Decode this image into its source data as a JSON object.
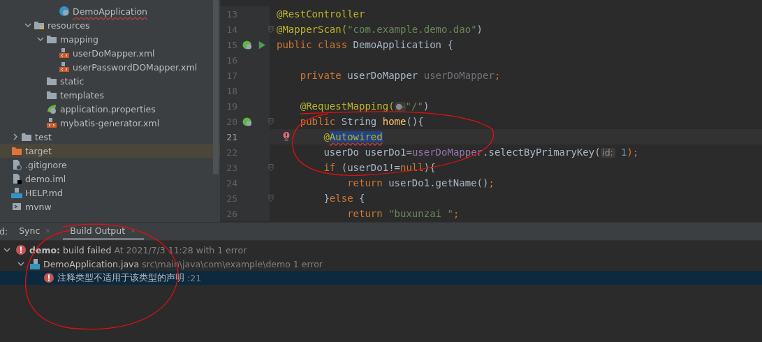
{
  "project_tree": [
    {
      "children": [
        {
          "children": [
            {
              "children": [
                {
                  "children": [
                    {
                      "label": "DemoApplication",
                      "kind": "java-class",
                      "error": true,
                      "selected": false
                    }
                  ]
                }
              ]
            },
            {
              "label": "resources",
              "kind": "resources-folder",
              "expanded": true,
              "selected": false,
              "children": [
                {
                  "label": "mapping",
                  "kind": "folder",
                  "expanded": true,
                  "selected": false,
                  "children": [
                    {
                      "label": "userDoMapper.xml",
                      "kind": "xml",
                      "selected": false
                    },
                    {
                      "label": "userPasswordDOMapper.xml",
                      "kind": "xml",
                      "selected": false
                    }
                  ]
                },
                {
                  "label": "static",
                  "kind": "folder",
                  "selected": false
                },
                {
                  "label": "templates",
                  "kind": "folder",
                  "selected": false
                },
                {
                  "label": "application.properties",
                  "kind": "properties",
                  "selected": false
                },
                {
                  "label": "mybatis-generator.xml",
                  "kind": "xml",
                  "selected": false
                }
              ]
            }
          ]
        },
        {
          "label": "test",
          "kind": "folder",
          "expanded": false,
          "selected": false
        }
      ]
    },
    {
      "label": "target",
      "kind": "excluded-folder",
      "selected": true
    },
    {
      "label": ".gitignore",
      "kind": "ignore",
      "selected": false
    },
    {
      "label": "demo.iml",
      "kind": "iml",
      "selected": false
    },
    {
      "label": "HELP.md",
      "kind": "md",
      "selected": false
    },
    {
      "label": "mvnw",
      "kind": "script",
      "selected": false
    }
  ],
  "editor": {
    "lines": [
      {
        "number": "13",
        "tokens": [
          {
            "text": "@RestController",
            "kind": "annotation"
          }
        ]
      },
      {
        "number": "14",
        "fold": true,
        "tokens": [
          {
            "text": "@MapperScan(",
            "kind": "annotation"
          },
          {
            "text": "\"com.example.demo.dao\"",
            "kind": "string"
          },
          {
            "text": ")",
            "kind": "plain"
          }
        ]
      },
      {
        "number": "15",
        "gutter": [
          {
            "kind": "bean"
          },
          {
            "kind": "run"
          }
        ],
        "tokens": [
          {
            "text": "public class ",
            "kind": "keyword"
          },
          {
            "text": "DemoApplication {",
            "kind": "plain"
          }
        ]
      },
      {
        "number": "16"
      },
      {
        "number": "17",
        "tokens": [
          {
            "text": "    private ",
            "kind": "keyword"
          },
          {
            "text": "userDoMapper ",
            "kind": "plain"
          },
          {
            "text": "userDoMapper",
            "kind": "unused"
          },
          {
            "text": ";",
            "kind": "keyword"
          }
        ]
      },
      {
        "number": "18"
      },
      {
        "number": "19",
        "tokens": [
          {
            "text": "    @RequestMapping(",
            "kind": "annotation"
          },
          {
            "kind": "globe-inlay"
          },
          {
            "text": "\"/\"",
            "kind": "string"
          },
          {
            "text": ")",
            "kind": "plain"
          }
        ]
      },
      {
        "number": "20",
        "fold": true,
        "gutter": [
          {
            "kind": "bean"
          }
        ],
        "tokens": [
          {
            "text": "    public ",
            "kind": "keyword"
          },
          {
            "text": "String ",
            "kind": "plain"
          },
          {
            "text": "home",
            "kind": "method"
          },
          {
            "text": "(){",
            "kind": "plain"
          }
        ]
      },
      {
        "number": "21",
        "current": true,
        "error": true,
        "tokens": [
          {
            "text": "        @",
            "kind": "annotation"
          },
          {
            "text": "Autowired",
            "kind": "selected-error"
          }
        ]
      },
      {
        "number": "22",
        "tokens": [
          {
            "text": "        userDo userDo1=",
            "kind": "plain"
          },
          {
            "text": "userDoMapper",
            "kind": "field"
          },
          {
            "text": ".selectByPrimaryKey(",
            "kind": "plain"
          },
          {
            "text": "id:",
            "kind": "inlay"
          },
          {
            "text": " 1",
            "kind": "number"
          },
          {
            "text": ");",
            "kind": "keyword"
          }
        ]
      },
      {
        "number": "23",
        "fold": true,
        "tokens": [
          {
            "text": "        if ",
            "kind": "keyword"
          },
          {
            "text": "(userDo1!=",
            "kind": "plain"
          },
          {
            "text": "null",
            "kind": "keyword"
          },
          {
            "text": "){",
            "kind": "plain"
          }
        ]
      },
      {
        "number": "24",
        "tokens": [
          {
            "text": "            return ",
            "kind": "keyword"
          },
          {
            "text": "userDo1.getName()",
            "kind": "plain"
          },
          {
            "text": ";",
            "kind": "keyword"
          }
        ]
      },
      {
        "number": "25",
        "fold": true,
        "tokens": [
          {
            "text": "        }",
            "kind": "plain"
          },
          {
            "text": "else ",
            "kind": "keyword"
          },
          {
            "text": "{",
            "kind": "plain"
          }
        ]
      },
      {
        "number": "26",
        "tokens": [
          {
            "text": "            return ",
            "kind": "keyword"
          },
          {
            "text": "\"buxunzai \"",
            "kind": "string"
          },
          {
            "text": ";",
            "kind": "keyword"
          }
        ]
      }
    ]
  },
  "build_panel": {
    "label": "d:",
    "tabs": [
      {
        "label": "Sync",
        "selected": false
      },
      {
        "label": "Build Output",
        "selected": true
      }
    ],
    "rows": [
      {
        "kind": "build",
        "title": "demo:",
        "text": " build failed",
        "detail": "At 2021/7/3 11:28 with 1 error",
        "expanded": true,
        "selected": false,
        "children": [
          {
            "kind": "file",
            "text": "DemoApplication.java",
            "detail": "src\\main\\java\\com\\example\\demo 1 error",
            "expanded": true,
            "selected": false,
            "children": [
              {
                "kind": "error",
                "text": "注释类型不适用于该类型的声明",
                "detail": ":21",
                "selected": true
              }
            ]
          }
        ]
      }
    ]
  },
  "annotations": [
    {
      "kind": "ellipse"
    },
    {
      "kind": "ellipse"
    }
  ]
}
